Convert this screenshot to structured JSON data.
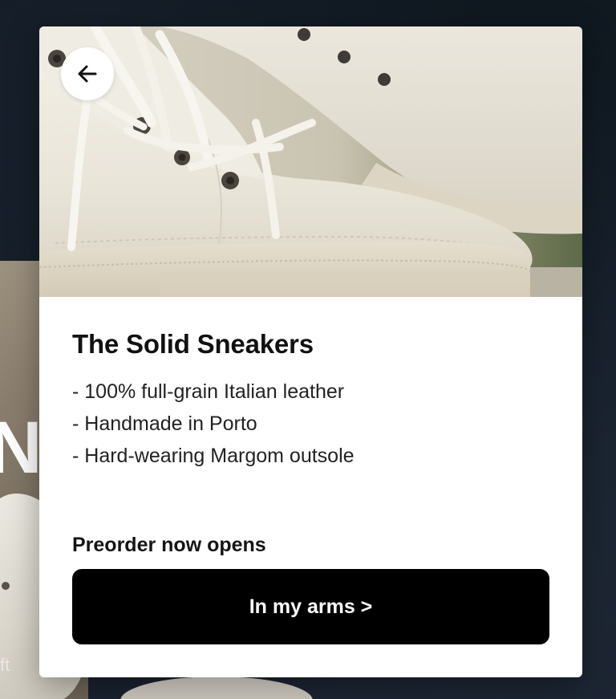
{
  "background": {
    "heading_fragment": "N",
    "caption_fragment": "ft"
  },
  "product_modal": {
    "back_button_icon": "arrow-left-icon",
    "title": "The Solid Sneakers",
    "features": [
      "- 100% full-grain Italian leather",
      "- Handmade in Porto",
      "- Hard-wearing Margom outsole"
    ],
    "preorder_text": "Preorder now opens",
    "cta_label": "In my arms >"
  },
  "colors": {
    "card_background": "#ffffff",
    "cta_background": "#000000",
    "cta_text": "#ffffff",
    "page_background": "#0f1722"
  }
}
